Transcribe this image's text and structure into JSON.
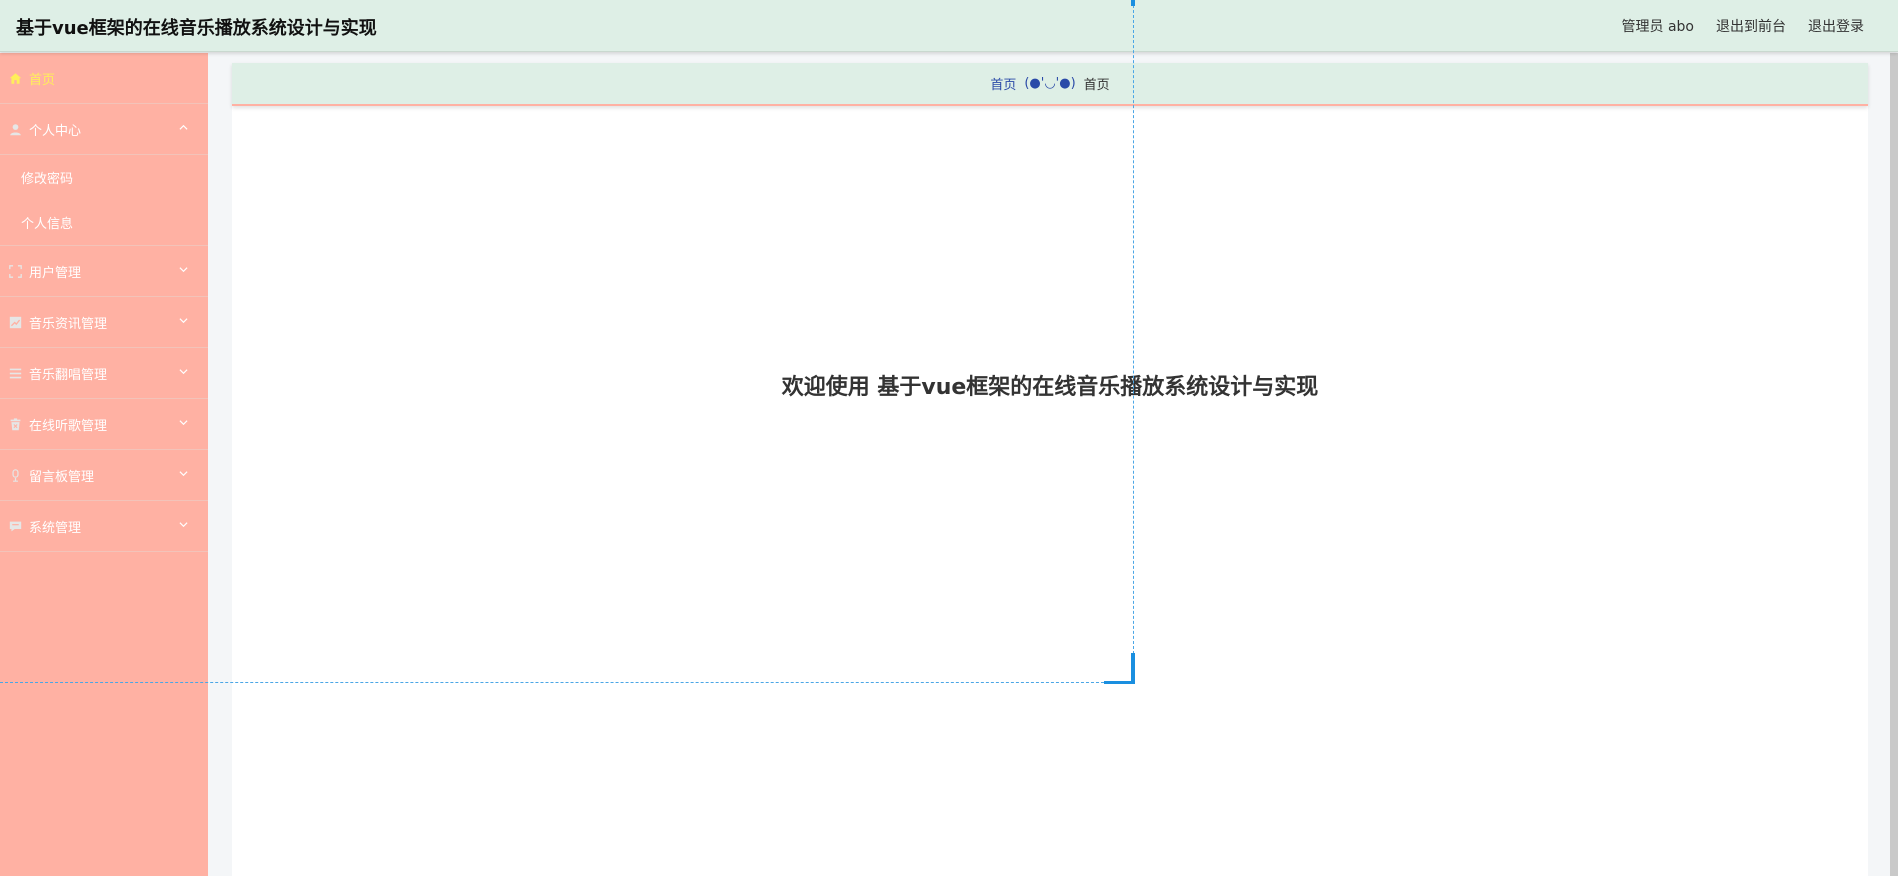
{
  "header": {
    "title": "基于vue框架的在线音乐播放系统设计与实现",
    "user_label": "管理员 abo",
    "front_label": "退出到前台",
    "logout_label": "退出登录"
  },
  "sidebar": {
    "items": [
      {
        "label": "首页",
        "icon": "home-icon",
        "active": true
      },
      {
        "label": "个人中心",
        "icon": "user-icon",
        "expanded": true
      },
      {
        "label": "用户管理",
        "icon": "frame-icon"
      },
      {
        "label": "音乐资讯管理",
        "icon": "chart-icon"
      },
      {
        "label": "音乐翻唱管理",
        "icon": "list-icon"
      },
      {
        "label": "在线听歌管理",
        "icon": "trash-icon"
      },
      {
        "label": "留言板管理",
        "icon": "microphone-icon"
      },
      {
        "label": "系统管理",
        "icon": "chat-icon"
      }
    ],
    "personal_center_sub": [
      {
        "label": "修改密码"
      },
      {
        "label": "个人信息"
      }
    ]
  },
  "breadcrumb": {
    "link": "首页",
    "separator": "(●'◡'●)",
    "current": "首页"
  },
  "main": {
    "welcome": "欢迎使用 基于vue框架的在线音乐播放系统设计与实现"
  },
  "colors": {
    "sidebar_bg": "#ffb1a3",
    "header_bg": "#deefe6",
    "active_text": "#ffef5a",
    "guide": "#1a8fe0"
  }
}
